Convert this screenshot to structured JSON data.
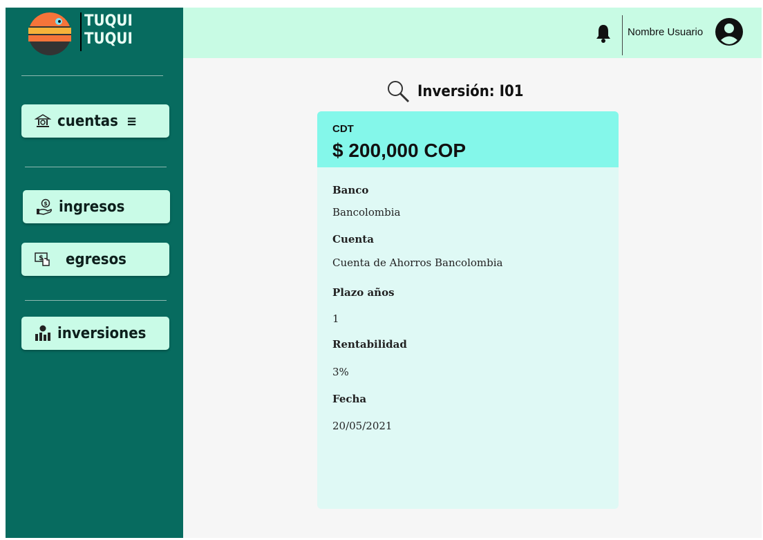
{
  "brand": {
    "line1": "TUQUI",
    "line2": "TUQUI"
  },
  "sidebar": {
    "items": [
      {
        "label": "cuentas",
        "icon": "bank-icon",
        "menu_icon": "≡"
      },
      {
        "label": "ingresos",
        "icon": "hand-coin-icon"
      },
      {
        "label": "egresos",
        "icon": "cash-hand-icon"
      },
      {
        "label": "inversiones",
        "icon": "investment-icon"
      }
    ]
  },
  "header": {
    "username": "Nombre Usuario",
    "bell_icon": "bell-icon",
    "avatar_icon": "user-avatar-icon"
  },
  "page": {
    "title": "Inversión: I01",
    "title_icon": "search-icon"
  },
  "card": {
    "type": "CDT",
    "amount": "$ 200,000 COP",
    "fields": [
      {
        "label": "Banco",
        "value": "Bancolombia"
      },
      {
        "label": "Cuenta",
        "value": "Cuenta de Ahorros Bancolombia"
      },
      {
        "label": "Plazo años",
        "value": "1"
      },
      {
        "label": "Rentabilidad",
        "value": "3%"
      },
      {
        "label": "Fecha",
        "value": "20/05/2021"
      }
    ]
  },
  "colors": {
    "sidebar": "#076b5f",
    "header": "#c8fbe4",
    "nav_button": "#c9fbe7",
    "card_head": "#84f7ea",
    "card_body": "#dff9f5"
  }
}
